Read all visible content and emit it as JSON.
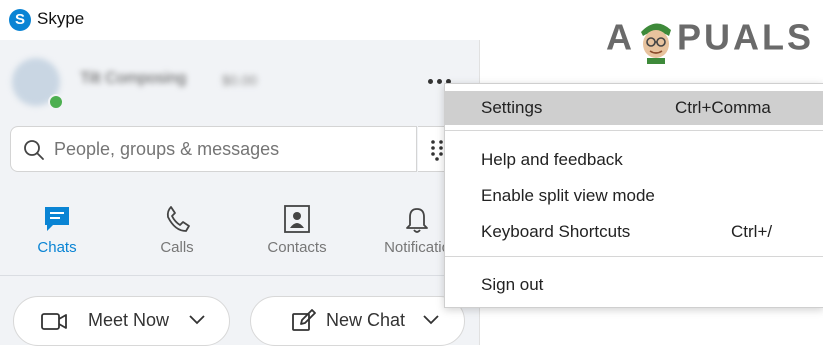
{
  "window": {
    "title": "Skype"
  },
  "watermark": {
    "text_a": "A",
    "text_rest": "PUALS"
  },
  "profile": {
    "name": "Tilt Composing",
    "credit": "$0.00"
  },
  "search": {
    "placeholder": "People, groups & messages"
  },
  "nav": {
    "tabs": [
      {
        "label": "Chats",
        "icon": "chat-icon",
        "active": true
      },
      {
        "label": "Calls",
        "icon": "phone-icon",
        "active": false
      },
      {
        "label": "Contacts",
        "icon": "contacts-icon",
        "active": false
      },
      {
        "label": "Notificatio",
        "icon": "bell-icon",
        "active": false
      }
    ]
  },
  "actions": {
    "meet_now": "Meet Now",
    "new_chat": "New Chat"
  },
  "menu": {
    "items": [
      {
        "label": "Settings",
        "shortcut": "Ctrl+Comma",
        "highlighted": true
      },
      {
        "label": "Help and feedback",
        "shortcut": ""
      },
      {
        "label": "Enable split view mode",
        "shortcut": ""
      },
      {
        "label": "Keyboard Shortcuts",
        "shortcut": "Ctrl+/"
      },
      {
        "label": "Sign out",
        "shortcut": ""
      }
    ]
  },
  "colors": {
    "accent": "#0a84d4",
    "panel": "#f1f3f6",
    "highlight": "#cfcfcf",
    "presence": "#4caf50"
  }
}
